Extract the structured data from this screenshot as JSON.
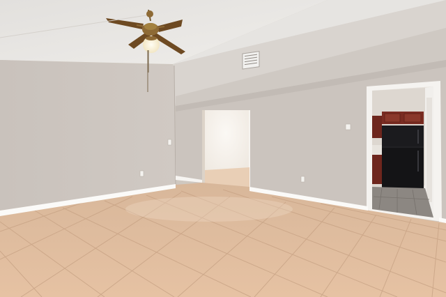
{
  "scene": {
    "description_visible_text": [],
    "palette": {
      "ceiling": "#e9e7e4",
      "wall": "#cdc6c0",
      "wall_shadow": "#bdb5ae",
      "floor": "#e2bfa0",
      "grout": "#c9a486",
      "baseboard": "#fbfaf8",
      "doorway_light": "#f4efe9",
      "cabinet": "#7a2c22",
      "fridge": "#141416",
      "fan_wood": "#6e4a22",
      "fan_brass": "#8e6a35"
    }
  }
}
